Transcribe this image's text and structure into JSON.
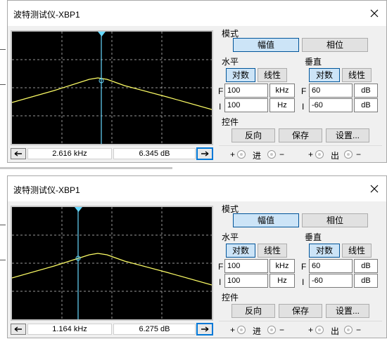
{
  "windows": [
    {
      "title": "波特测试仪-XBP1",
      "mode_label": "模式",
      "magnitude_label": "幅值",
      "phase_label": "相位",
      "horizontal": {
        "label": "水平",
        "log_label": "对数",
        "linear_label": "线性",
        "final_value": "100",
        "final_unit": "kHz",
        "initial_value": "100",
        "initial_unit": "Hz"
      },
      "vertical": {
        "label": "垂直",
        "log_label": "对数",
        "linear_label": "线性",
        "final_value": "60",
        "final_unit": "dB",
        "initial_value": "-60",
        "initial_unit": "dB"
      },
      "final_prefix": "F",
      "initial_prefix": "I",
      "controls_label": "控件",
      "reverse_label": "反向",
      "save_label": "保存",
      "setup_label": "设置...",
      "in_label": "进",
      "out_label": "出",
      "plus": "+",
      "minus": "−",
      "readout_freq": "2.616 kHz",
      "readout_gain": "6.345 dB",
      "cursor_fraction": 0.45,
      "colors": {
        "trace": "#ffff66",
        "cursor": "#66d9ff",
        "grid": "#ffffff",
        "selected": "#cce4f7"
      },
      "icons": {
        "close": "close-icon",
        "left": "arrow-left-icon",
        "right": "arrow-right-icon"
      }
    },
    {
      "title": "波特测试仪-XBP1",
      "mode_label": "模式",
      "magnitude_label": "幅值",
      "phase_label": "相位",
      "horizontal": {
        "label": "水平",
        "log_label": "对数",
        "linear_label": "线性",
        "final_value": "100",
        "final_unit": "kHz",
        "initial_value": "100",
        "initial_unit": "Hz"
      },
      "vertical": {
        "label": "垂直",
        "log_label": "对数",
        "linear_label": "线性",
        "final_value": "60",
        "final_unit": "dB",
        "initial_value": "-60",
        "initial_unit": "dB"
      },
      "final_prefix": "F",
      "initial_prefix": "I",
      "controls_label": "控件",
      "reverse_label": "反向",
      "save_label": "保存",
      "setup_label": "设置...",
      "in_label": "进",
      "out_label": "出",
      "plus": "+",
      "minus": "−",
      "readout_freq": "1.164 kHz",
      "readout_gain": "6.275 dB",
      "cursor_fraction": 0.33,
      "colors": {
        "trace": "#ffff66",
        "cursor": "#66d9ff",
        "grid": "#ffffff",
        "selected": "#cce4f7"
      },
      "icons": {
        "close": "close-icon",
        "left": "arrow-left-icon",
        "right": "arrow-right-icon"
      }
    }
  ]
}
